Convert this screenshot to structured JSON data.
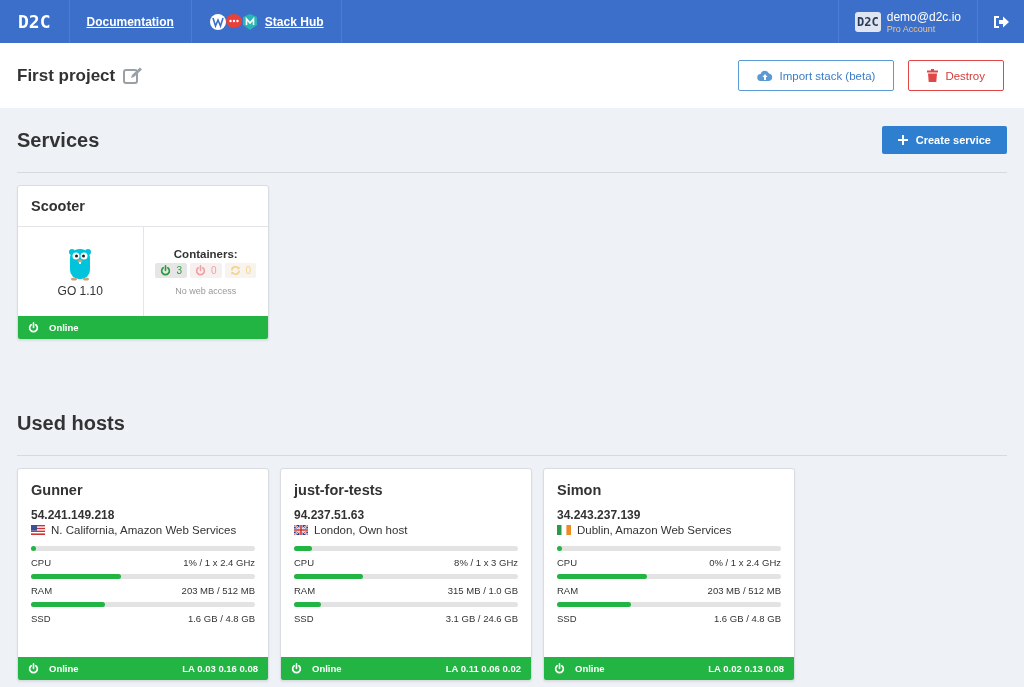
{
  "navbar": {
    "logo": "D2C",
    "links": [
      {
        "label": "Documentation",
        "kind": "plain"
      },
      {
        "label": "Stack Hub",
        "kind": "hub"
      }
    ],
    "user": {
      "logo": "D2C",
      "email": "demo@d2c.io",
      "plan": "Pro Account"
    }
  },
  "project": {
    "title": "First project",
    "buttons": [
      {
        "label": "Import stack (beta)",
        "kind": "import"
      },
      {
        "label": "Destroy",
        "kind": "destroy"
      }
    ]
  },
  "services": {
    "title": "Services",
    "create_button": "Create service",
    "items": [
      {
        "name": "Scooter",
        "runtime": "GO 1.10",
        "containers_label": "Containers:",
        "containers": [
          {
            "kind": "running",
            "count": "3"
          },
          {
            "kind": "stopped",
            "count": "0"
          },
          {
            "kind": "restarting",
            "count": "0"
          }
        ],
        "web_access": "No web access",
        "status": "Online"
      }
    ]
  },
  "hosts": {
    "title": "Used hosts",
    "items": [
      {
        "name": "Gunner",
        "ip": "54.241.149.218",
        "flag": {
          "kind": "us"
        },
        "location": "N. California, Amazon Web Services",
        "metrics": [
          {
            "label": "CPU",
            "reading": "1% / 1 x 2.4 GHz",
            "level": 0.01
          },
          {
            "label": "RAM",
            "reading": "203 MB / 512 MB",
            "level": 0.4
          },
          {
            "label": "SSD",
            "reading": "1.6 GB / 4.8 GB",
            "level": 0.33
          }
        ],
        "status": "Online",
        "load": "LA 0.03 0.16 0.08"
      },
      {
        "name": "just-for-tests",
        "ip": "94.237.51.63",
        "flag": {
          "kind": "gb"
        },
        "location": "London, Own host",
        "metrics": [
          {
            "label": "CPU",
            "reading": "8% / 1 x 3 GHz",
            "level": 0.08
          },
          {
            "label": "RAM",
            "reading": "315 MB / 1.0 GB",
            "level": 0.31
          },
          {
            "label": "SSD",
            "reading": "3.1 GB / 24.6 GB",
            "level": 0.12
          }
        ],
        "status": "Online",
        "load": "LA 0.11 0.06 0.02"
      },
      {
        "name": "Simon",
        "ip": "34.243.237.139",
        "flag": {
          "kind": "ie"
        },
        "location": "Dublin, Amazon Web Services",
        "metrics": [
          {
            "label": "CPU",
            "reading": "0% / 1 x 2.4 GHz",
            "level": 0.01
          },
          {
            "label": "RAM",
            "reading": "203 MB / 512 MB",
            "level": 0.4
          },
          {
            "label": "SSD",
            "reading": "1.6 GB / 4.8 GB",
            "level": 0.33
          }
        ],
        "status": "Online",
        "load": "LA 0.02 0.13 0.08"
      }
    ]
  }
}
